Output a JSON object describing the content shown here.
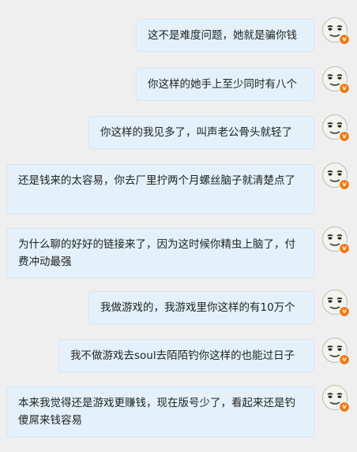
{
  "messages": [
    {
      "text": "这不是难度问题，她就是骗你钱",
      "avatar_icon": "meme-face-avatar",
      "badge": "v"
    },
    {
      "text": "你这样的她手上至少同时有八个",
      "avatar_icon": "meme-face-avatar",
      "badge": "v"
    },
    {
      "text": "你这样的我见多了，叫声老公骨头就轻了",
      "avatar_icon": "meme-face-avatar",
      "badge": "v"
    },
    {
      "text": "还是钱来的太容易，你去厂里拧两个月螺丝脑子就清楚点了",
      "avatar_icon": "meme-face-avatar",
      "badge": "v"
    },
    {
      "text": "为什么聊的好好的链接来了，因为这时候你精虫上脑了，付费冲动最强",
      "avatar_icon": "meme-face-avatar",
      "badge": "v"
    },
    {
      "text": "我做游戏的，我游戏里你这样的有10万个",
      "avatar_icon": "meme-face-avatar",
      "badge": "v"
    },
    {
      "text": "我不做游戏去soul去陌陌钓你这样的也能过日子",
      "avatar_icon": "meme-face-avatar",
      "badge": "v"
    },
    {
      "text": "本来我觉得还是游戏更赚钱，现在版号少了，看起来还是钓傻屌来钱容易",
      "avatar_icon": "meme-face-avatar",
      "badge": "v"
    }
  ],
  "colors": {
    "background": "#efefef",
    "bubble": "#e4f1fb",
    "badge": "#f07c1a"
  }
}
